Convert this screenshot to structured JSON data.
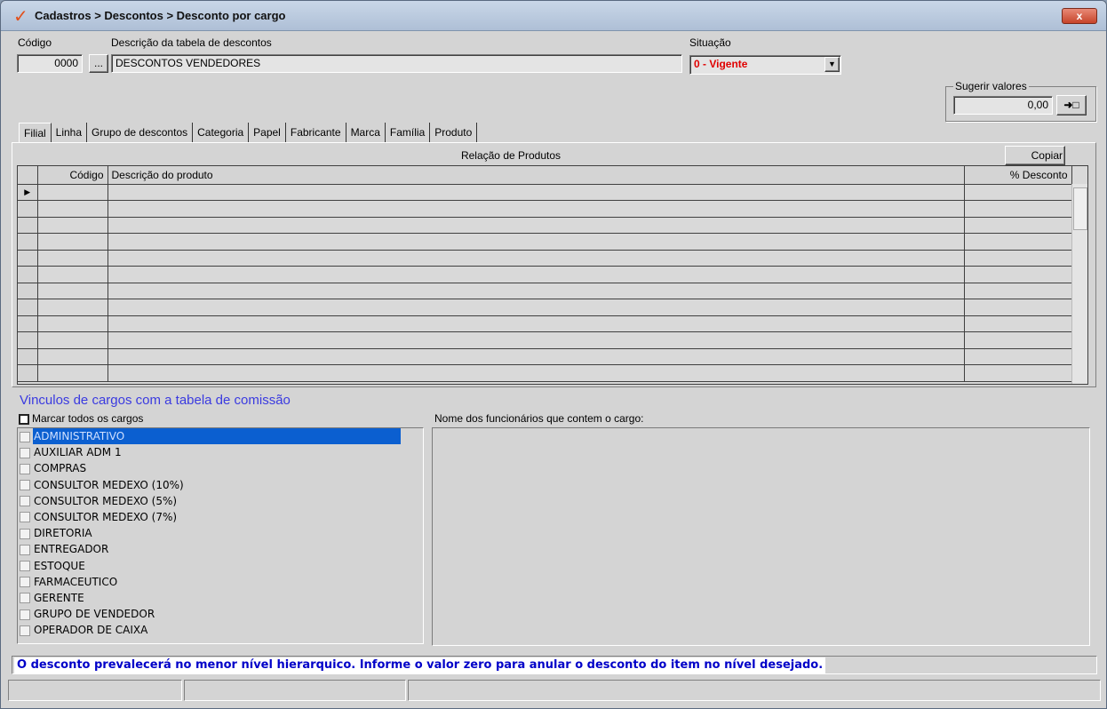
{
  "window": {
    "title": "Cadastros > Descontos > Desconto por cargo",
    "close_label": "x",
    "app_icon": "check-icon"
  },
  "form": {
    "codigo_label": "Código",
    "codigo_value": "0000",
    "lookup_label": "...",
    "descricao_label": "Descrição da tabela de descontos",
    "descricao_value": "DESCONTOS VENDEDORES",
    "situacao_label": "Situação",
    "situacao_value": "0 - Vigente",
    "situacao_color": "#e00000"
  },
  "sugerir": {
    "legend": "Sugerir valores",
    "value": "0,00",
    "apply_label": "➜□"
  },
  "tabs": [
    {
      "label": "Filial"
    },
    {
      "label": "Linha"
    },
    {
      "label": "Grupo de descontos"
    },
    {
      "label": "Categoria"
    },
    {
      "label": "Papel"
    },
    {
      "label": "Fabricante"
    },
    {
      "label": "Marca"
    },
    {
      "label": "Família"
    },
    {
      "label": "Produto"
    }
  ],
  "produtos": {
    "header": "Relação de Produtos",
    "copy_label": "Copiar",
    "columns": [
      "Código",
      "Descrição do produto",
      "% Desconto"
    ],
    "row_count": 12
  },
  "vinculos": {
    "title": "Vinculos de cargos com a tabela de comissão",
    "mark_all_label": "Marcar todos os cargos",
    "cargos": [
      "ADMINISTRATIVO",
      "AUXILIAR ADM 1",
      "COMPRAS",
      "CONSULTOR MEDEXO (10%)",
      "CONSULTOR MEDEXO (5%)",
      "CONSULTOR MEDEXO (7%)",
      "DIRETORIA",
      "ENTREGADOR",
      "ESTOQUE",
      "FARMACEUTICO",
      "GERENTE",
      "GRUPO DE VENDEDOR",
      "OPERADOR DE CAIXA"
    ],
    "funcionarios_label": "Nome dos funcionários que contem o cargo:"
  },
  "info": {
    "message": "O desconto prevalecerá no menor nível hierarquico. Informe o valor zero para anular o desconto do item no nível desejado."
  }
}
